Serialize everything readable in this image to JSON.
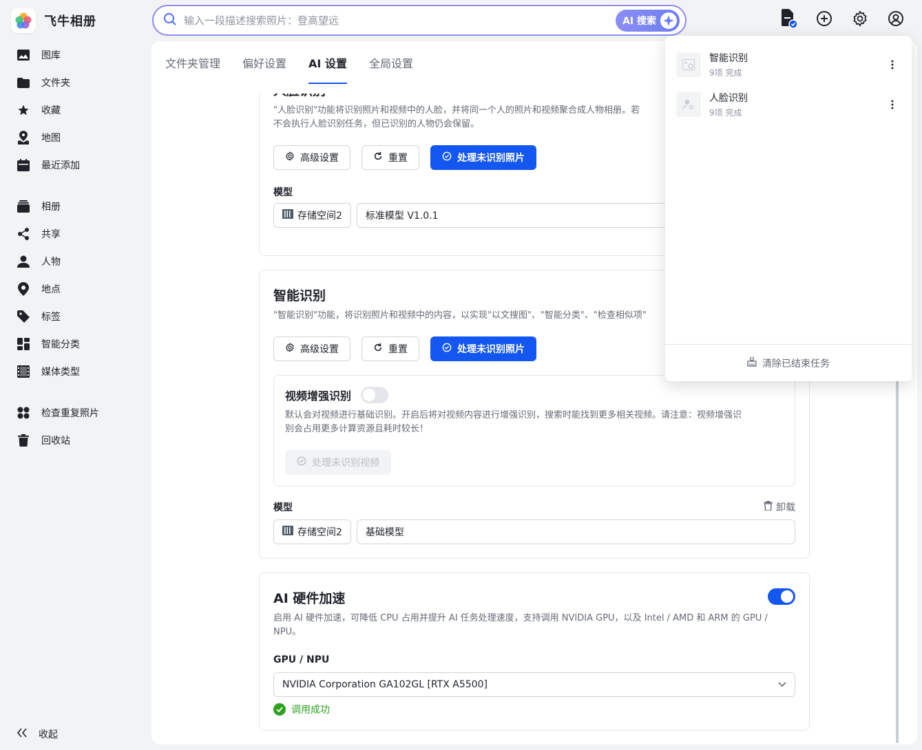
{
  "app": {
    "name": "飞牛相册"
  },
  "search": {
    "placeholder": "输入一段描述搜索照片：登高望远",
    "ai_label": "AI 搜索"
  },
  "sidebar": {
    "items": [
      {
        "label": "图库",
        "icon": "gallery-icon"
      },
      {
        "label": "文件夹",
        "icon": "folder-icon"
      },
      {
        "label": "收藏",
        "icon": "star-icon"
      },
      {
        "label": "地图",
        "icon": "map-icon"
      },
      {
        "label": "最近添加",
        "icon": "calendar-icon"
      },
      {
        "label": "相册",
        "icon": "album-icon"
      },
      {
        "label": "共享",
        "icon": "share-icon"
      },
      {
        "label": "人物",
        "icon": "person-icon"
      },
      {
        "label": "地点",
        "icon": "location-pin-icon"
      },
      {
        "label": "标签",
        "icon": "tag-icon"
      },
      {
        "label": "智能分类",
        "icon": "grid-icon"
      },
      {
        "label": "媒体类型",
        "icon": "film-icon"
      },
      {
        "label": "检查重复照片",
        "icon": "duplicate-icon"
      },
      {
        "label": "回收站",
        "icon": "trash-icon"
      }
    ],
    "collapse_label": "收起"
  },
  "tabs": [
    {
      "label": "文件夹管理",
      "active": false
    },
    {
      "label": "偏好设置",
      "active": false
    },
    {
      "label": "AI 设置",
      "active": true
    },
    {
      "label": "全局设置",
      "active": false
    }
  ],
  "face": {
    "title": "人脸识别",
    "desc_line1": "\"人脸识别\"功能将识别照片和视频中的人脸，并将同一个人的照片和视频聚合成人物相册。若",
    "desc_line2": "不会执行人脸识别任务，但已识别的人物仍会保留。",
    "advanced_label": "高级设置",
    "reset_label": "重置",
    "process_label": "处理未识别照片",
    "model_label": "模型",
    "storage": "存储空间2",
    "model_name": "标准模型 V1.0.1"
  },
  "smart": {
    "title": "智能识别",
    "desc": "\"智能识别\"功能，将识别照片和视频中的内容，以实现\"以文搜图\"、\"智能分类\"、\"检查相似项\"",
    "advanced_label": "高级设置",
    "reset_label": "重置",
    "process_label": "处理未识别照片",
    "video": {
      "title": "视频增强识别",
      "enabled": false,
      "desc_line1": "默认会对视频进行基础识别。开启后将对视频内容进行增强识别，搜索时能找到更多相关视频。请注意：视频增强识",
      "desc_line2": "别会占用更多计算资源且耗时较长！",
      "process_label": "处理未识别视频"
    },
    "model_label": "模型",
    "uninstall_label": "卸载",
    "storage": "存储空间2",
    "model_name": "基础模型"
  },
  "hw": {
    "title": "AI 硬件加速",
    "enabled": true,
    "desc_line1": "启用 AI 硬件加速，可降低 CPU 占用并提升 AI 任务处理速度，支持调用 NVIDIA GPU，以及 Intel / AMD 和 ARM 的 GPU /",
    "desc_line2": "NPU。",
    "gpu_label": "GPU / NPU",
    "gpu_value": "NVIDIA Corporation GA102GL [RTX A5500]",
    "status": "调用成功"
  },
  "tasks": {
    "items": [
      {
        "name": "智能识别",
        "status": "9项 完成"
      },
      {
        "name": "人脸识别",
        "status": "9项 完成"
      }
    ],
    "clear_label": "清除已结束任务"
  },
  "colors": {
    "accent": "#1456f0",
    "success": "#2ea121",
    "search_border": "#8d8cf3"
  }
}
